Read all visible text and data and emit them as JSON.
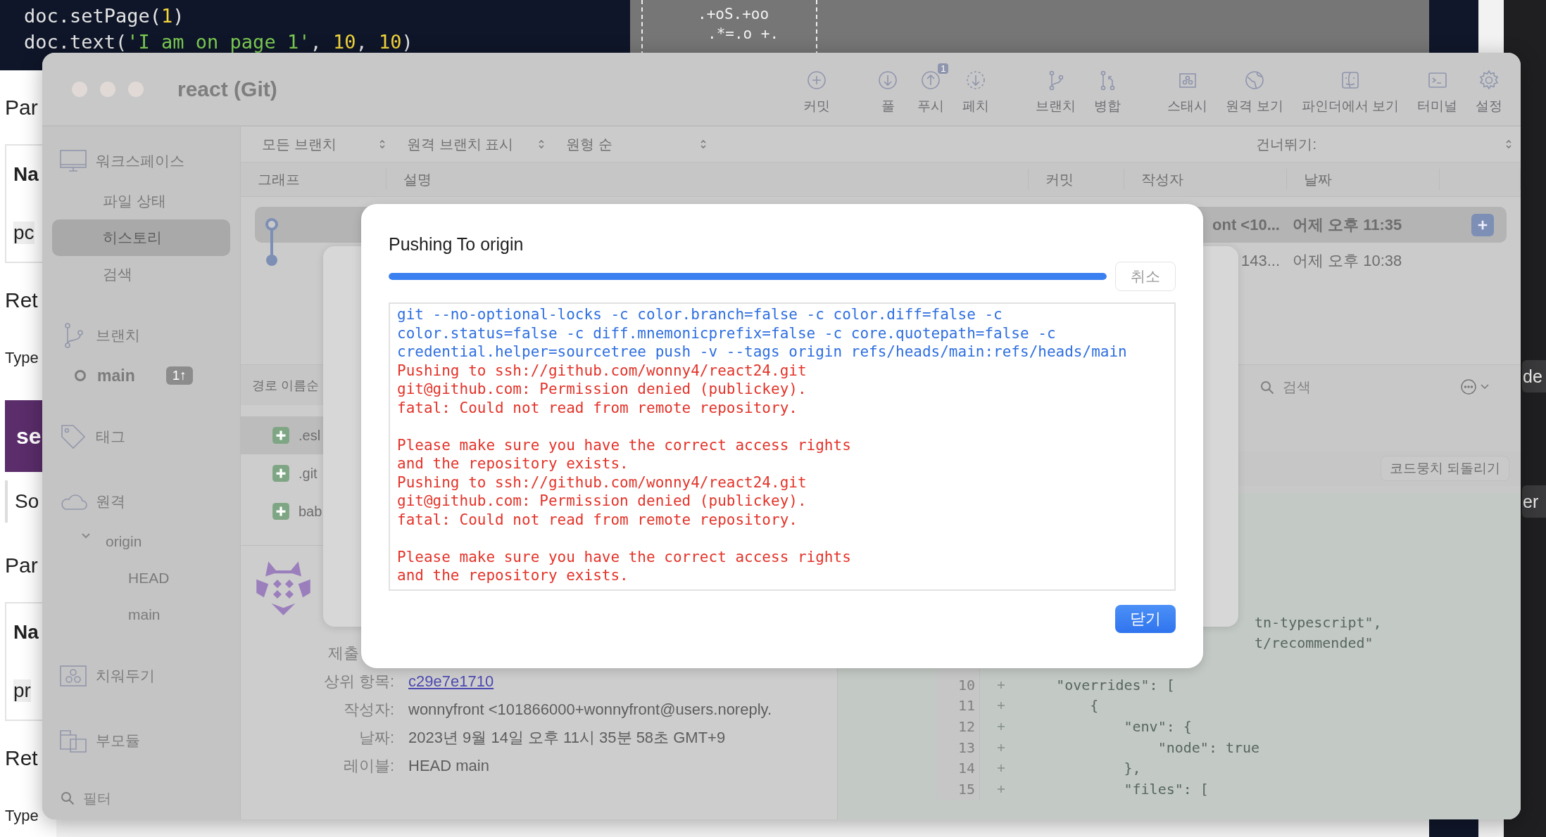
{
  "background": {
    "editor_lines": [
      [
        {
          "kind": "plain",
          "text": "doc.setPage("
        },
        {
          "kind": "number",
          "text": "1"
        },
        {
          "kind": "plain",
          "text": ")"
        }
      ],
      [
        {
          "kind": "plain",
          "text": "doc.text("
        },
        {
          "kind": "string",
          "text": "'I am on page 1'"
        },
        {
          "kind": "plain",
          "text": ", "
        },
        {
          "kind": "number",
          "text": "10"
        },
        {
          "kind": "plain",
          "text": ", "
        },
        {
          "kind": "number",
          "text": "10"
        },
        {
          "kind": "plain",
          "text": ")"
        }
      ]
    ],
    "terminal_lines": [
      ".+oS.+oo",
      ".*=.o +."
    ],
    "page_texts": [
      {
        "kind": "heading",
        "text": "Par"
      },
      {
        "kind": "table",
        "header": "Na",
        "cell": "pc"
      },
      {
        "kind": "heading",
        "text": "Ret"
      },
      {
        "kind": "label",
        "text": "Type"
      },
      {
        "kind": "banner",
        "text": "se"
      },
      {
        "kind": "quote",
        "text": "So"
      },
      {
        "kind": "heading",
        "text": "Par"
      },
      {
        "kind": "table",
        "header": "Na",
        "cell": "pr"
      },
      {
        "kind": "heading",
        "text": "Ret"
      },
      {
        "kind": "label",
        "text": "Type"
      }
    ],
    "side_buttons": [
      "de",
      "er"
    ]
  },
  "window": {
    "title": "react (Git)",
    "toolbar": [
      {
        "items": [
          {
            "label": "커밋",
            "kind": "commit"
          }
        ]
      },
      {
        "items": [
          {
            "label": "풀",
            "kind": "pull"
          },
          {
            "label": "푸시",
            "kind": "push",
            "badge": "1"
          },
          {
            "label": "페치",
            "kind": "fetch"
          }
        ]
      },
      {
        "items": [
          {
            "label": "브랜치",
            "kind": "branch"
          },
          {
            "label": "병합",
            "kind": "merge"
          }
        ]
      },
      {
        "items": [
          {
            "label": "스태시",
            "kind": "stash"
          },
          {
            "label": "원격 보기",
            "kind": "remote"
          },
          {
            "label": "파인더에서 보기",
            "kind": "finder"
          },
          {
            "label": "터미널",
            "kind": "terminal"
          },
          {
            "label": "설정",
            "kind": "settings"
          }
        ]
      }
    ]
  },
  "sidebar": {
    "sections": [
      {
        "label": "워크스페이스",
        "kind": "workspace",
        "items": [
          {
            "label": "파일 상태",
            "selected": false
          },
          {
            "label": "히스토리",
            "selected": true
          },
          {
            "label": "검색",
            "selected": false
          }
        ]
      },
      {
        "label": "브랜치",
        "kind": "branches",
        "items": [
          {
            "label": "main",
            "selected": false,
            "current": true,
            "badge": "1↑"
          }
        ]
      },
      {
        "label": "태그",
        "kind": "tags"
      },
      {
        "label": "원격",
        "kind": "remotes",
        "items": [
          {
            "label": "origin",
            "selected": false,
            "expanded": true,
            "children": [
              {
                "label": "HEAD",
                "selected": false
              },
              {
                "label": "main",
                "selected": false
              }
            ]
          }
        ]
      },
      {
        "label": "치워두기",
        "kind": "stashes"
      },
      {
        "label": "부모듈",
        "kind": "submodules"
      }
    ],
    "filter": {
      "placeholder": "필터"
    }
  },
  "filter_bar": {
    "dropdowns": [
      "모든 브랜치",
      "원격 브랜치 표시",
      "원형 순"
    ],
    "jump_label": "건너뛰기:"
  },
  "history": {
    "columns": [
      "그래프",
      "설명",
      "커밋",
      "작성자",
      "날짜"
    ],
    "rows": [
      {
        "kind": "head",
        "author": "ont <10...",
        "date": "어제 오후 11:35",
        "selected": true
      },
      {
        "kind": "commit",
        "author": "143...",
        "date": "어제 오후 10:38",
        "selected": false
      }
    ]
  },
  "files": {
    "sort_label": "경로 이름순",
    "items": [
      {
        "name": ".esl",
        "kind": "added",
        "selected": true
      },
      {
        "name": ".git",
        "kind": "added",
        "selected": false
      },
      {
        "name": "bab",
        "kind": "added",
        "selected": false
      }
    ]
  },
  "details": [
    {
      "label": "제출",
      "kind": "covered"
    },
    {
      "label": "상위 항목:",
      "value": "c29e7e1710",
      "kind": "link"
    },
    {
      "label": "작성자:",
      "value": "wonnyfront <101866000+wonnyfront@users.noreply.",
      "kind": "text"
    },
    {
      "label": "날짜:",
      "value": "2023년 9월 14일 오후 11시 35분 58초 GMT+9",
      "kind": "text"
    },
    {
      "label": "레이블:",
      "value": "HEAD main",
      "kind": "text"
    }
  ],
  "diff": {
    "search": {
      "placeholder": "검색"
    },
    "hunk_button": "코드뭉치 되돌리기",
    "lines": [
      {
        "kind": "covered",
        "text": "tn-typescript\","
      },
      {
        "kind": "covered",
        "text": "t/recommended\""
      },
      {
        "kind": "covered_row"
      },
      {
        "kind": "added",
        "number": "10",
        "text": "    \"overrides\": ["
      },
      {
        "kind": "added",
        "number": "11",
        "text": "        {"
      },
      {
        "kind": "added",
        "number": "12",
        "text": "            \"env\": {"
      },
      {
        "kind": "added",
        "number": "13",
        "text": "                \"node\": true"
      },
      {
        "kind": "added",
        "number": "14",
        "text": "            },"
      },
      {
        "kind": "added",
        "number": "15",
        "text": "            \"files\": ["
      }
    ]
  },
  "dialog": {
    "title": "Pushing To origin",
    "progress": {
      "level": 1.0
    },
    "cancel": {
      "label": "취소",
      "disabled": true
    },
    "log": [
      {
        "kind": "command",
        "text": "git --no-optional-locks -c color.branch=false -c color.diff=false -c"
      },
      {
        "kind": "command",
        "text": "color.status=false -c diff.mnemonicprefix=false -c core.quotepath=false -c"
      },
      {
        "kind": "command",
        "text": "credential.helper=sourcetree push -v --tags origin refs/heads/main:refs/heads/main"
      },
      {
        "kind": "error",
        "text": "Pushing to ssh://github.com/wonny4/react24.git"
      },
      {
        "kind": "error",
        "text": "git@github.com: Permission denied (publickey)."
      },
      {
        "kind": "error",
        "text": "fatal: Could not read from remote repository."
      },
      {
        "kind": "blank"
      },
      {
        "kind": "error",
        "text": "Please make sure you have the correct access rights"
      },
      {
        "kind": "error",
        "text": "and the repository exists."
      },
      {
        "kind": "error",
        "text": "Pushing to ssh://github.com/wonny4/react24.git"
      },
      {
        "kind": "error",
        "text": "git@github.com: Permission denied (publickey)."
      },
      {
        "kind": "error",
        "text": "fatal: Could not read from remote repository."
      },
      {
        "kind": "blank"
      },
      {
        "kind": "error",
        "text": "Please make sure you have the correct access rights"
      },
      {
        "kind": "error",
        "text": "and the repository exists."
      }
    ],
    "close": "닫기"
  }
}
